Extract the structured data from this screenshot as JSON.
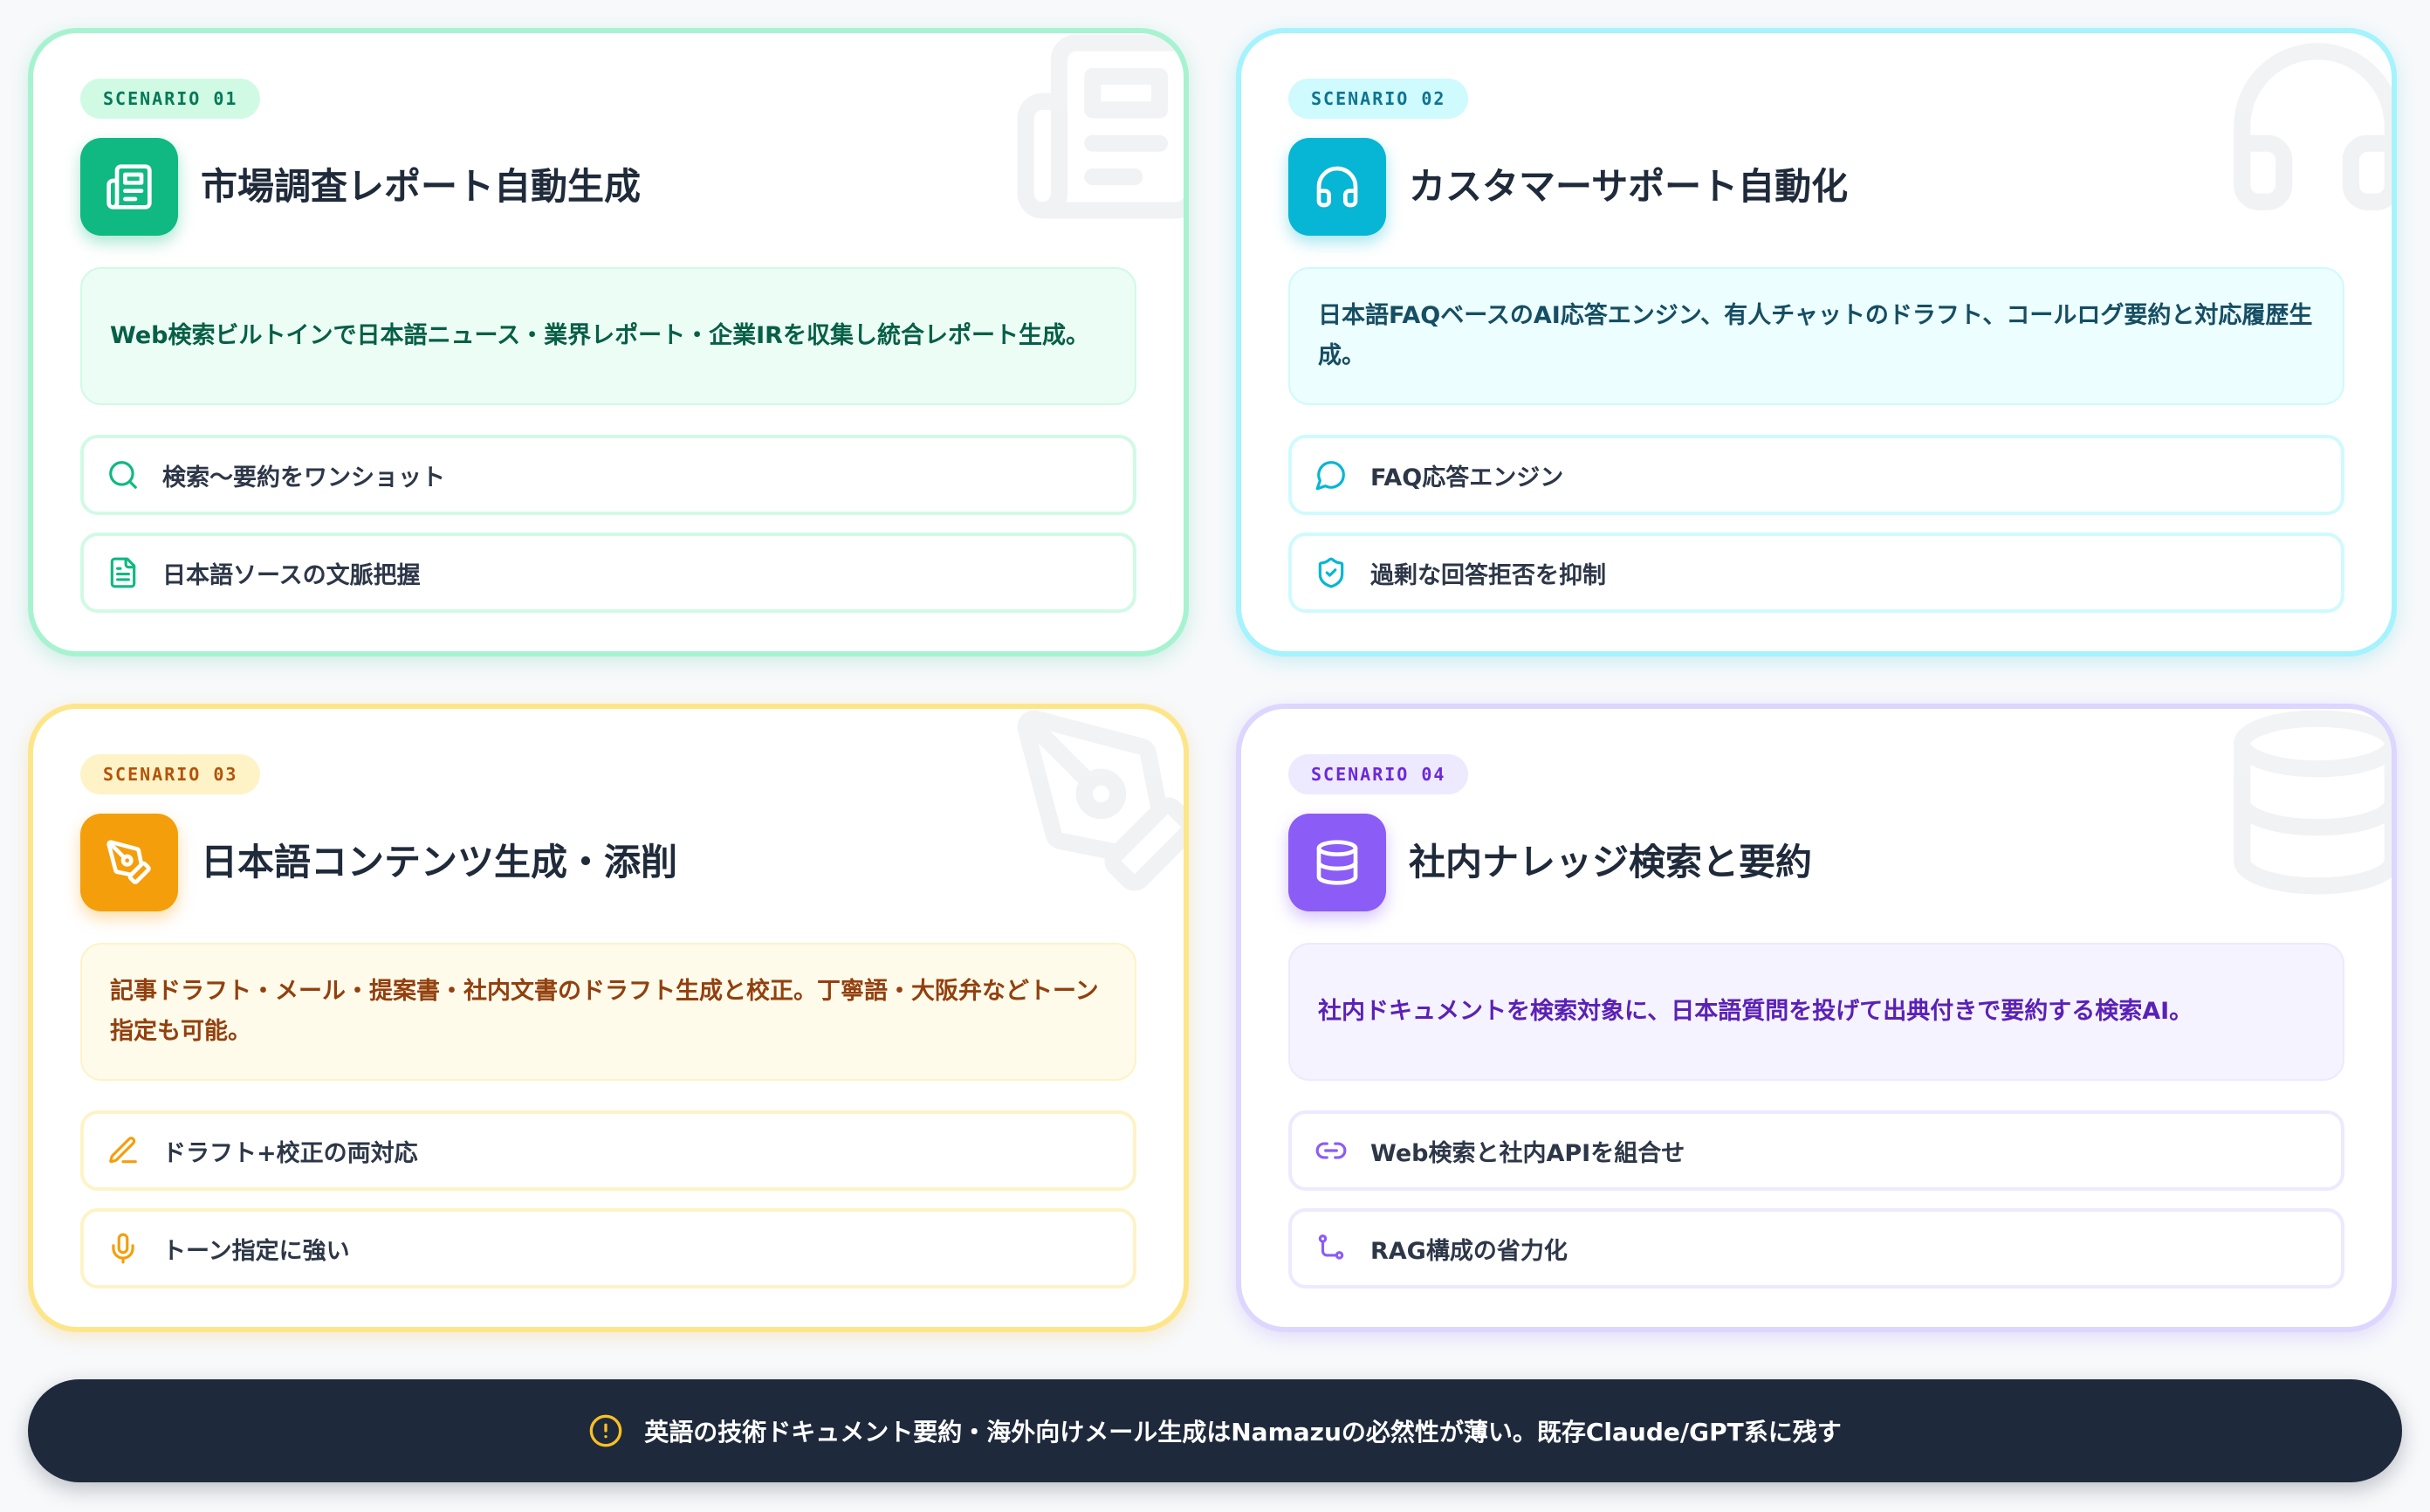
{
  "colors": {
    "green": "#10b981",
    "cyan": "#06b6d4",
    "amber": "#f59e0b",
    "violet": "#8b5cf6",
    "footer_bg": "#1e293b",
    "warning": "#fbbf24"
  },
  "scenarios": [
    {
      "badge": "SCENARIO 01",
      "icon": "newspaper-icon",
      "title": "市場調査レポート自動生成",
      "description": "Web検索ビルトインで日本語ニュース・業界レポート・企業IRを収集し統合レポート生成。",
      "features": [
        {
          "icon": "search-icon",
          "label": "検索〜要約をワンショット"
        },
        {
          "icon": "document-icon",
          "label": "日本語ソースの文脈把握"
        }
      ]
    },
    {
      "badge": "SCENARIO 02",
      "icon": "headphones-icon",
      "title": "カスタマーサポート自動化",
      "description": "日本語FAQベースのAI応答エンジン、有人チャットのドラフト、コールログ要約と対応履歴生成。",
      "features": [
        {
          "icon": "chat-bubble-icon",
          "label": "FAQ応答エンジン"
        },
        {
          "icon": "shield-check-icon",
          "label": "過剰な回答拒否を抑制"
        }
      ]
    },
    {
      "badge": "SCENARIO 03",
      "icon": "pen-tool-icon",
      "title": "日本語コンテンツ生成・添削",
      "description": "記事ドラフト・メール・提案書・社内文書のドラフト生成と校正。丁寧語・大阪弁などトーン指定も可能。",
      "features": [
        {
          "icon": "pencil-icon",
          "label": "ドラフト+校正の両対応"
        },
        {
          "icon": "microphone-icon",
          "label": "トーン指定に強い"
        }
      ]
    },
    {
      "badge": "SCENARIO 04",
      "icon": "database-icon",
      "title": "社内ナレッジ検索と要約",
      "description": "社内ドキュメントを検索対象に、日本語質問を投げて出典付きで要約する検索AI。",
      "features": [
        {
          "icon": "link-icon",
          "label": "Web検索と社内APIを組合せ"
        },
        {
          "icon": "git-branch-icon",
          "label": "RAG構成の省力化"
        }
      ]
    }
  ],
  "footer": {
    "icon": "alert-circle-icon",
    "text": "英語の技術ドキュメント要約・海外向けメール生成はNamazuの必然性が薄い。既存Claude/GPT系に残す"
  }
}
